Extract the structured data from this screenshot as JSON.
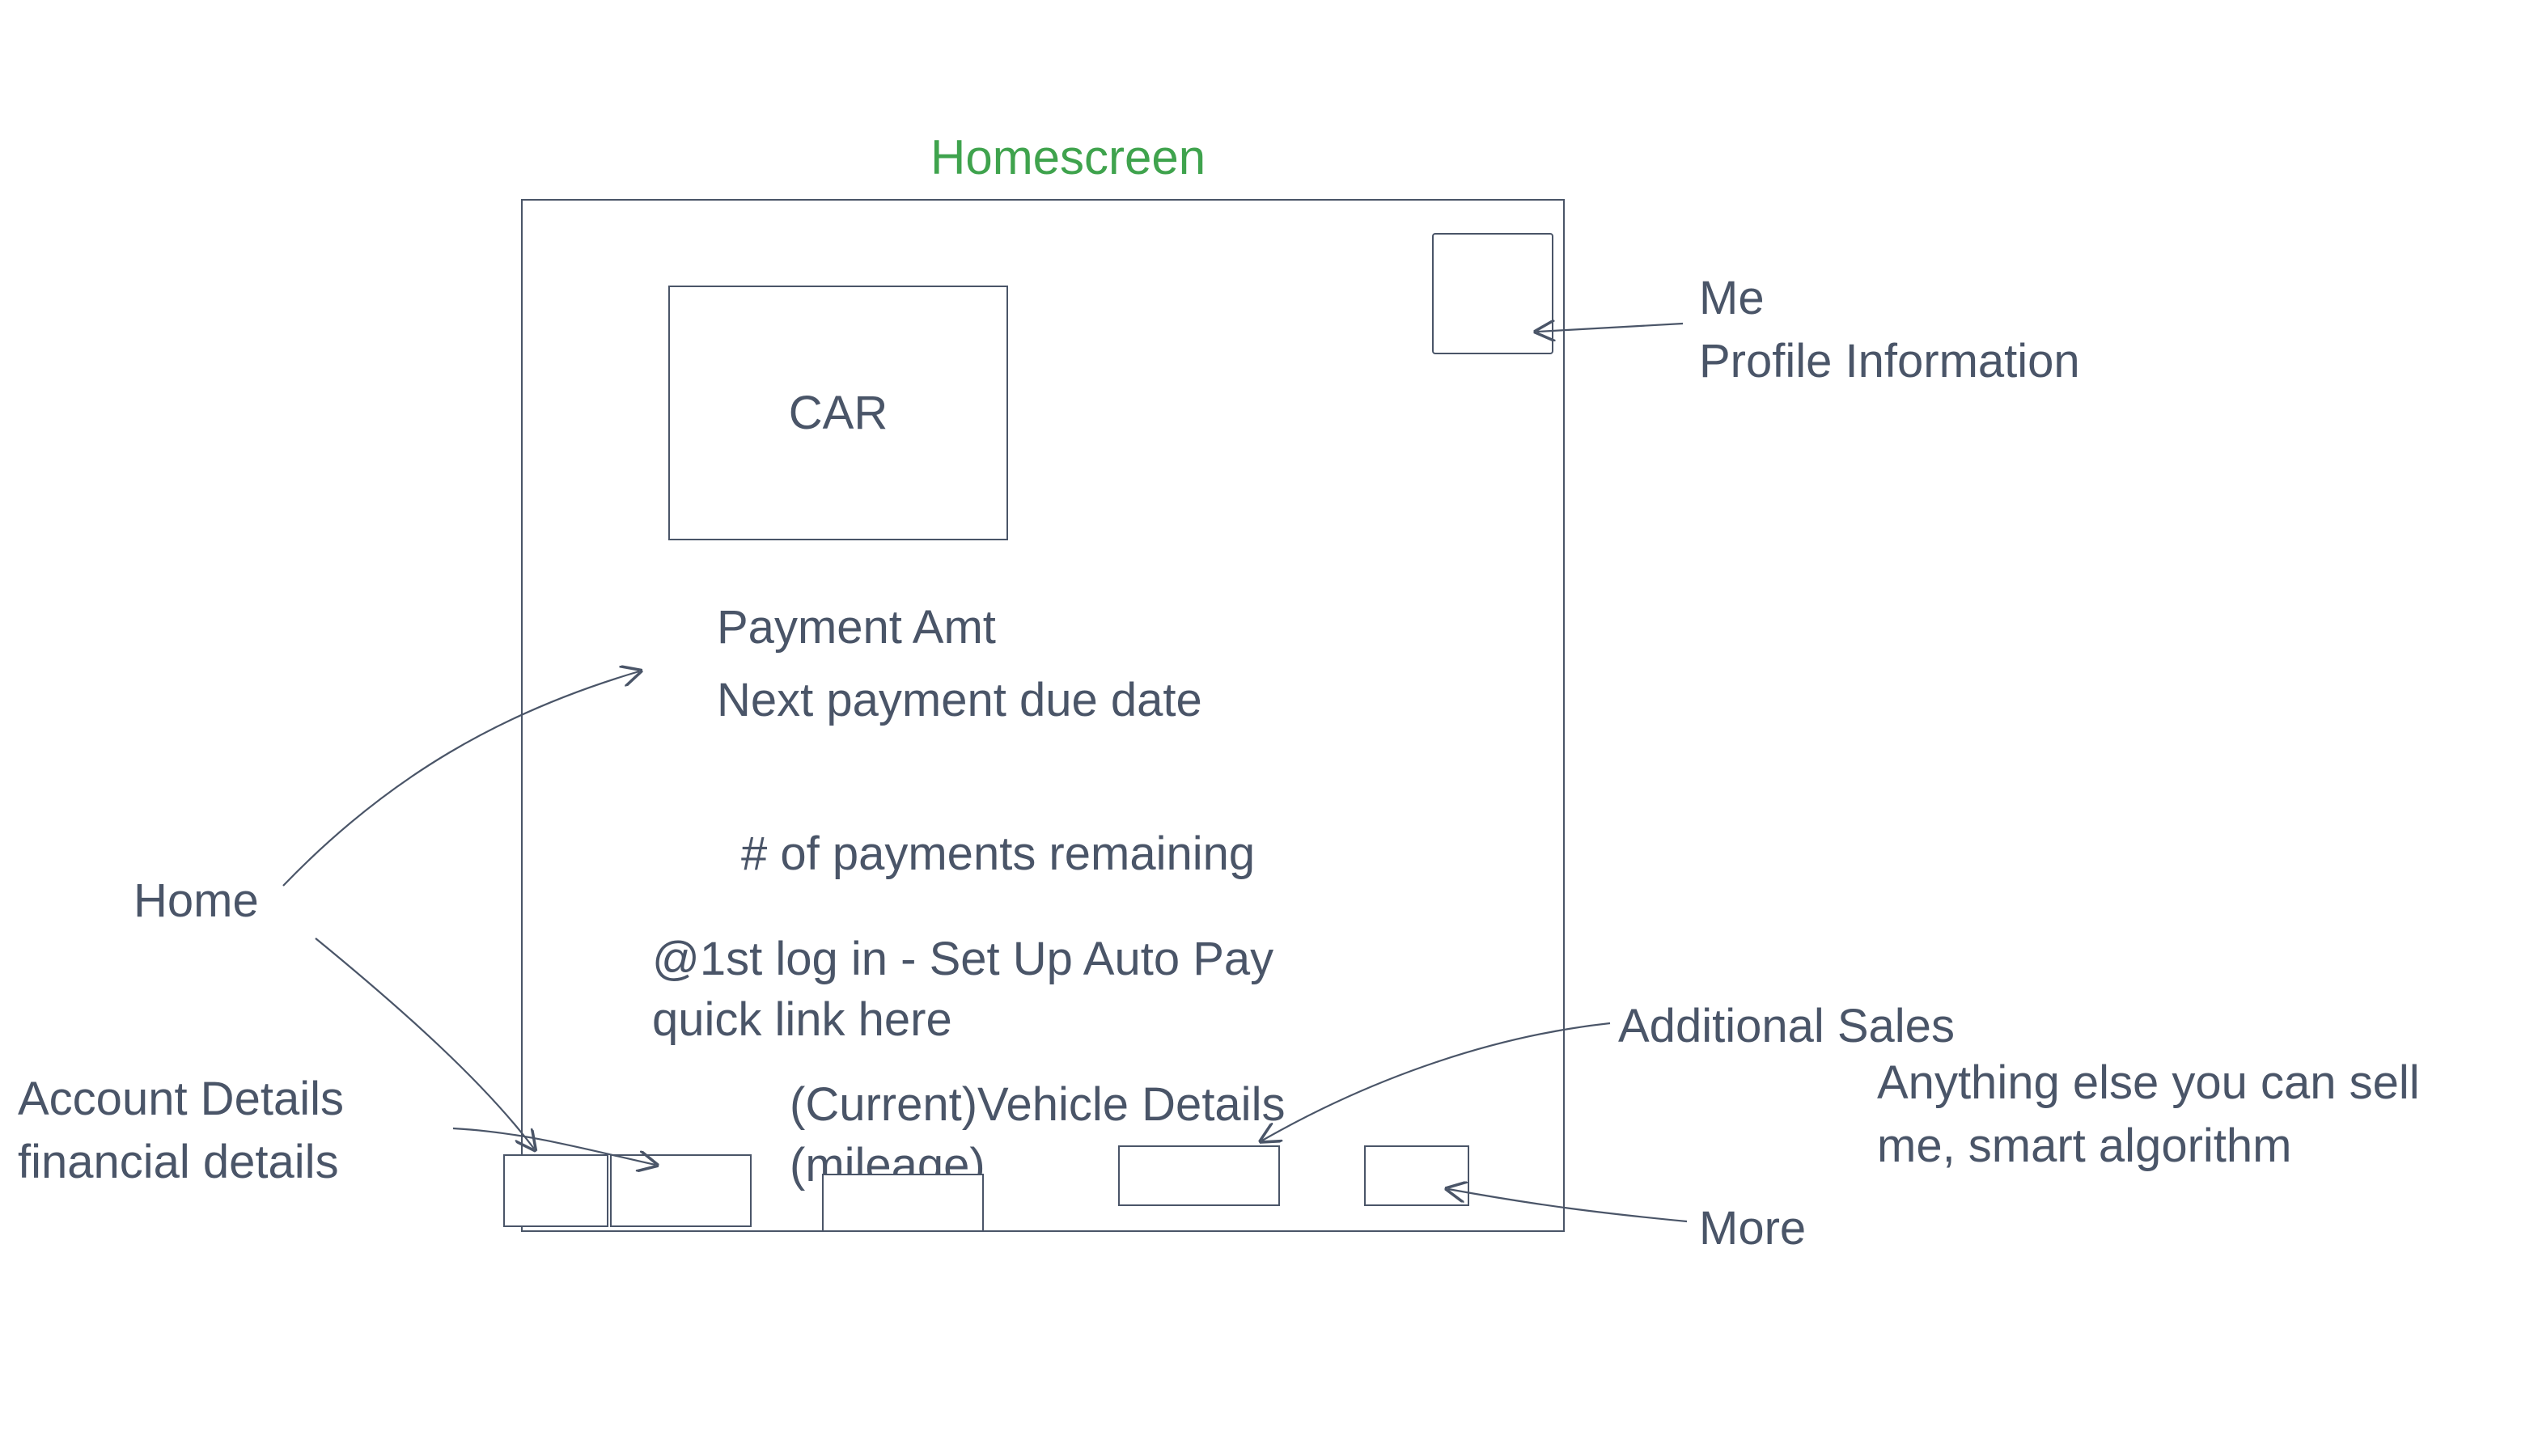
{
  "title": "Homescreen",
  "car_label": "CAR",
  "lines": {
    "payment_amt": "Payment Amt",
    "next_due": "Next payment due date",
    "payments_remaining": "# of payments remaining",
    "autopay": "@1st log in - Set Up Auto\nPay quick link here",
    "vehicle_details": "(Current)Vehicle Details\n(mileage)"
  },
  "annotations": {
    "me": "Me\nProfile Information",
    "home": "Home",
    "account": "Account Details\nfinancial details",
    "additional_sales": "Additional Sales",
    "additional_sales_sub": "Anything else you can sell\nme, smart algorithm",
    "more": "More"
  }
}
